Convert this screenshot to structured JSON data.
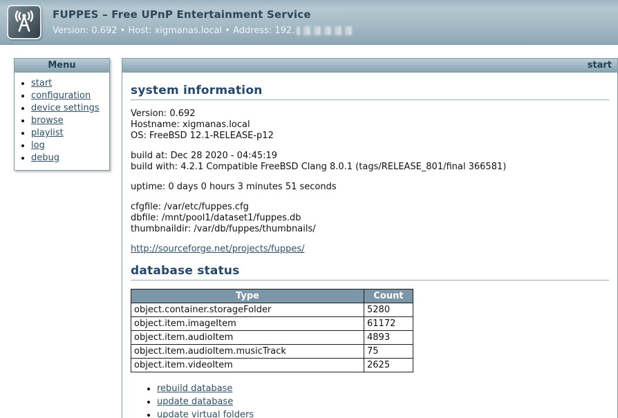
{
  "header": {
    "title": "FUPPES – Free UPnP Entertainment Service",
    "meta": "Version: 0.692 • Host: xigmanas.local • Address: 192.",
    "logo_icon": "antenna-icon"
  },
  "menu": {
    "title": "Menu",
    "items": [
      "start",
      "configuration",
      "device settings",
      "browse",
      "playlist",
      "log",
      "debug"
    ]
  },
  "content": {
    "current_page": "start",
    "system_information": {
      "heading": "system information",
      "version": "Version: 0.692",
      "hostname": "Hostname: xigmanas.local",
      "os": "OS: FreeBSD 12.1-RELEASE-p12",
      "build_at": "build at: Dec 28 2020 - 04:45:19",
      "build_with": "build with: 4.2.1 Compatible FreeBSD Clang 8.0.1 (tags/RELEASE_801/final 366581)",
      "uptime": "uptime: 0 days 0 hours 3 minutes 51 seconds",
      "cfgfile": "cfgfile: /var/etc/fuppes.cfg",
      "dbfile": "dbfile: /mnt/pool1/dataset1/fuppes.db",
      "thumbnaildir": "thumbnaildir: /var/db/fuppes/thumbnails/",
      "project_link": "http://sourceforge.net/projects/fuppes/"
    },
    "database_status": {
      "heading": "database status",
      "table": {
        "headers": [
          "Type",
          "Count"
        ],
        "rows": [
          {
            "type": "object.container.storageFolder",
            "count": "5280"
          },
          {
            "type": "object.item.imageItem",
            "count": "61172"
          },
          {
            "type": "object.item.audioItem",
            "count": "4893"
          },
          {
            "type": "object.item.audioItem.musicTrack",
            "count": "75"
          },
          {
            "type": "object.item.videoItem",
            "count": "2625"
          }
        ]
      },
      "actions": [
        "rebuild database",
        "update database",
        "update virtual folders"
      ]
    }
  },
  "colors": {
    "banner_top": "#b6c8d1",
    "banner_bottom": "#8ea7b4",
    "heading": "#24486b",
    "link": "#2d4f66",
    "table_header_bg": "#7b96a6"
  }
}
